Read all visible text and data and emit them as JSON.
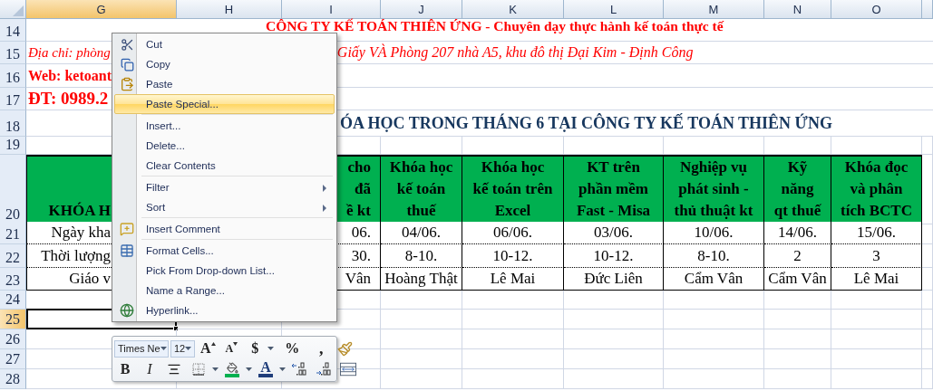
{
  "columns": [
    {
      "label": "G",
      "selected": true
    },
    {
      "label": "H",
      "selected": false
    },
    {
      "label": "I",
      "selected": false
    },
    {
      "label": "J",
      "selected": false
    },
    {
      "label": "K",
      "selected": false
    },
    {
      "label": "L",
      "selected": false
    },
    {
      "label": "M",
      "selected": false
    },
    {
      "label": "N",
      "selected": false
    },
    {
      "label": "O",
      "selected": false
    }
  ],
  "rows": [
    {
      "number": "14",
      "selected": false,
      "kind": "banner",
      "texts": [
        {
          "kind": "company",
          "text": "CÔNG TY KẾ TOÁN THIÊN ỨNG - Chuyên dạy thực hành kế toán thực tế"
        }
      ]
    },
    {
      "number": "15",
      "selected": false,
      "kind": "banner",
      "texts": [
        {
          "kind": "address",
          "text": "Địa chỉ: phòng"
        },
        {
          "kind": "address-tail",
          "text": "Giấy VÀ Phòng 207 nhà A5, khu đô thị Đại Kim - Định Công"
        }
      ]
    },
    {
      "number": "16",
      "selected": false,
      "kind": "banner",
      "texts": [
        {
          "kind": "web",
          "text": "Web: ketoant"
        }
      ]
    },
    {
      "number": "17",
      "selected": false,
      "kind": "banner",
      "texts": [
        {
          "kind": "phone",
          "text": "ĐT: 0989.2"
        }
      ]
    },
    {
      "number": "18",
      "selected": false,
      "kind": "banner",
      "texts": [
        {
          "kind": "heading",
          "text": "ÓA HỌC TRONG THÁNG 6 TẠI CÔNG TY KẾ TOÁN THIÊN ỨNG"
        }
      ]
    },
    {
      "number": "19",
      "selected": false,
      "kind": "blank"
    },
    {
      "number": "20",
      "selected": false,
      "kind": "table-header",
      "cells": [
        "KHÓA H",
        "cho\nđã\nề kt",
        "Khóa học\nkế toán\nthuế",
        "Khóa học\nkế toán trên\nExcel",
        "KT trên\nphần mềm\nFast - Misa",
        "Nghiệp vụ\nphát sinh -\nthủ thuật kt",
        "Kỹ\nnăng\nqt thuế",
        "Khóa đọc\nvà phân\ntích BCTC"
      ]
    },
    {
      "number": "21",
      "selected": false,
      "kind": "table-row",
      "cells": [
        "Ngày kha",
        "06.",
        "04/06.",
        "06/06.",
        "03/06.",
        "10/06.",
        "14/06.",
        "15/06."
      ]
    },
    {
      "number": "22",
      "selected": false,
      "kind": "table-row",
      "cells": [
        "Thời lượng",
        "30.",
        "8-10.",
        "10-12.",
        "10-12.",
        "8-10.",
        "2",
        "3"
      ]
    },
    {
      "number": "23",
      "selected": false,
      "kind": "table-row",
      "cells": [
        "Giáo v",
        "Vân",
        "Hoàng Thật",
        "Lê Mai",
        "Đức Liên",
        "Cẩm Vân",
        "Cẩm Vân",
        "Lê Mai"
      ]
    },
    {
      "number": "24",
      "selected": false,
      "kind": "blank"
    },
    {
      "number": "25",
      "selected": true,
      "kind": "blank"
    },
    {
      "number": "26",
      "selected": false,
      "kind": "blank"
    },
    {
      "number": "27",
      "selected": false,
      "kind": "blank"
    },
    {
      "number": "28",
      "selected": false,
      "kind": "blank"
    }
  ],
  "menu": {
    "items": [
      {
        "kind": "item",
        "label": "Cut",
        "selected": false,
        "submenu": false
      },
      {
        "kind": "item",
        "label": "Copy",
        "selected": false,
        "submenu": false
      },
      {
        "kind": "item",
        "label": "Paste",
        "selected": false,
        "submenu": false
      },
      {
        "kind": "item",
        "label": "Paste Special...",
        "selected": true,
        "submenu": false
      },
      {
        "kind": "separator"
      },
      {
        "kind": "item",
        "label": "Insert...",
        "selected": false,
        "submenu": false
      },
      {
        "kind": "item",
        "label": "Delete...",
        "selected": false,
        "submenu": false
      },
      {
        "kind": "item",
        "label": "Clear Contents",
        "selected": false,
        "submenu": false
      },
      {
        "kind": "separator"
      },
      {
        "kind": "item",
        "label": "Filter",
        "selected": false,
        "submenu": true
      },
      {
        "kind": "item",
        "label": "Sort",
        "selected": false,
        "submenu": true
      },
      {
        "kind": "separator"
      },
      {
        "kind": "item",
        "label": "Insert Comment",
        "selected": false,
        "submenu": false
      },
      {
        "kind": "separator"
      },
      {
        "kind": "item",
        "label": "Format Cells...",
        "selected": false,
        "submenu": false
      },
      {
        "kind": "item",
        "label": "Pick From Drop-down List...",
        "selected": false,
        "submenu": false
      },
      {
        "kind": "item",
        "label": "Name a Range...",
        "selected": false,
        "submenu": false
      },
      {
        "kind": "item",
        "label": "Hyperlink...",
        "selected": false,
        "submenu": false
      }
    ]
  },
  "toolbar": {
    "font": "Times Ne",
    "size": "12",
    "rows": [
      [
        {
          "kind": "grow-font",
          "label": "A"
        },
        {
          "kind": "shrink-font",
          "label": "A"
        },
        {
          "kind": "currency",
          "label": "$"
        },
        {
          "kind": "percent",
          "label": "%"
        },
        {
          "kind": "comma",
          "label": ","
        },
        {
          "kind": "painter"
        }
      ],
      [
        {
          "kind": "bold",
          "label": "B"
        },
        {
          "kind": "italic",
          "label": "I"
        },
        {
          "kind": "center"
        },
        {
          "kind": "borders"
        },
        {
          "kind": "fill"
        },
        {
          "kind": "font-color",
          "label": "A"
        },
        {
          "kind": "increase-decimal"
        },
        {
          "kind": "decrease-decimal"
        },
        {
          "kind": "merge"
        }
      ]
    ]
  }
}
